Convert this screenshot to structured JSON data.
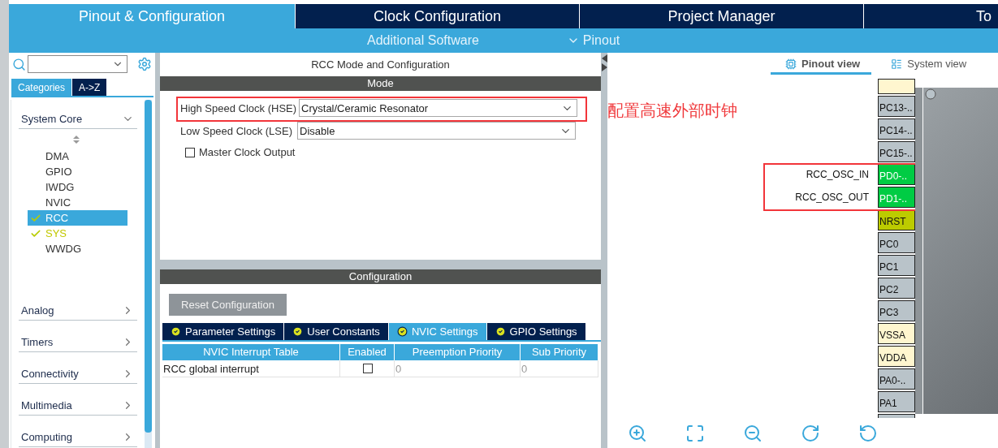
{
  "top_tabs": [
    {
      "label": "Pinout & Configuration",
      "selected": true
    },
    {
      "label": "Clock Configuration",
      "selected": false
    },
    {
      "label": "Project Manager",
      "selected": false
    },
    {
      "label": "To",
      "selected": false
    }
  ],
  "sub_menu": [
    {
      "label": "Additional Software",
      "kind": "link"
    },
    {
      "label": "Pinout",
      "kind": "dropdown"
    }
  ],
  "sidebar": {
    "tabs": [
      {
        "label": "Categories",
        "selected": true
      },
      {
        "label": "A->Z",
        "selected": false
      }
    ],
    "categories": [
      {
        "label": "System Core",
        "expanded": true,
        "children": [
          {
            "label": "DMA",
            "configured": false,
            "warning": false,
            "selected": false
          },
          {
            "label": "GPIO",
            "configured": false,
            "warning": false,
            "selected": false
          },
          {
            "label": "IWDG",
            "configured": false,
            "warning": false,
            "selected": false
          },
          {
            "label": "NVIC",
            "configured": false,
            "warning": false,
            "selected": false
          },
          {
            "label": "RCC",
            "configured": true,
            "warning": false,
            "selected": true
          },
          {
            "label": "SYS",
            "configured": true,
            "warning": true,
            "selected": false
          },
          {
            "label": "WWDG",
            "configured": false,
            "warning": false,
            "selected": false
          }
        ]
      },
      {
        "label": "Analog",
        "expanded": false
      },
      {
        "label": "Timers",
        "expanded": false
      },
      {
        "label": "Connectivity",
        "expanded": false
      },
      {
        "label": "Multimedia",
        "expanded": false
      },
      {
        "label": "Computing",
        "expanded": false
      }
    ]
  },
  "mode_panel": {
    "title": "RCC Mode and Configuration",
    "section": "Mode",
    "fields": [
      {
        "kind": "select",
        "label": "High Speed Clock (HSE)",
        "value": "Crystal/Ceramic Resonator",
        "highlighted": true
      },
      {
        "kind": "select",
        "label": "Low Speed Clock (LSE)",
        "value": "Disable"
      },
      {
        "kind": "checkbox",
        "label": "Master Clock Output",
        "checked": false
      }
    ]
  },
  "config_panel": {
    "section": "Configuration",
    "reset_button": {
      "label": "Reset Configuration",
      "disabled": true
    },
    "tabs": [
      {
        "label": "Parameter Settings",
        "selected": false
      },
      {
        "label": "User Constants",
        "selected": false
      },
      {
        "label": "NVIC Settings",
        "selected": true
      },
      {
        "label": "GPIO Settings",
        "selected": false
      }
    ],
    "table": {
      "columns": [
        "NVIC Interrupt Table",
        "Enabled",
        "Preemption Priority",
        "Sub Priority"
      ],
      "rows": [
        {
          "interrupt": "RCC global interrupt",
          "enabled": false,
          "preemption_priority": "0",
          "sub_priority": "0"
        }
      ]
    }
  },
  "pinout": {
    "view_tabs": [
      {
        "label": "Pinout view",
        "selected": true
      },
      {
        "label": "System view",
        "selected": false
      }
    ],
    "note": "配置高速外部时钟",
    "pins": [
      {
        "kind": "power"
      },
      {
        "name": "PC13-..",
        "kind": "io"
      },
      {
        "name": "PC14-..",
        "kind": "io"
      },
      {
        "name": "PC15-..",
        "kind": "io"
      },
      {
        "name": "PD0-..",
        "kind": "assigned",
        "signal": "RCC_OSC_IN",
        "highlighted": true
      },
      {
        "name": "PD1-..",
        "kind": "assigned",
        "signal": "RCC_OSC_OUT",
        "highlighted": true
      },
      {
        "name": "NRST",
        "kind": "reset"
      },
      {
        "name": "PC0",
        "kind": "io"
      },
      {
        "name": "PC1",
        "kind": "io"
      },
      {
        "name": "PC2",
        "kind": "io"
      },
      {
        "name": "PC3",
        "kind": "io"
      },
      {
        "name": "VSSA",
        "kind": "power"
      },
      {
        "name": "VDDA",
        "kind": "power"
      },
      {
        "name": "PA0-..",
        "kind": "io"
      },
      {
        "name": "PA1",
        "kind": "io"
      },
      {
        "kind": "io"
      }
    ]
  }
}
